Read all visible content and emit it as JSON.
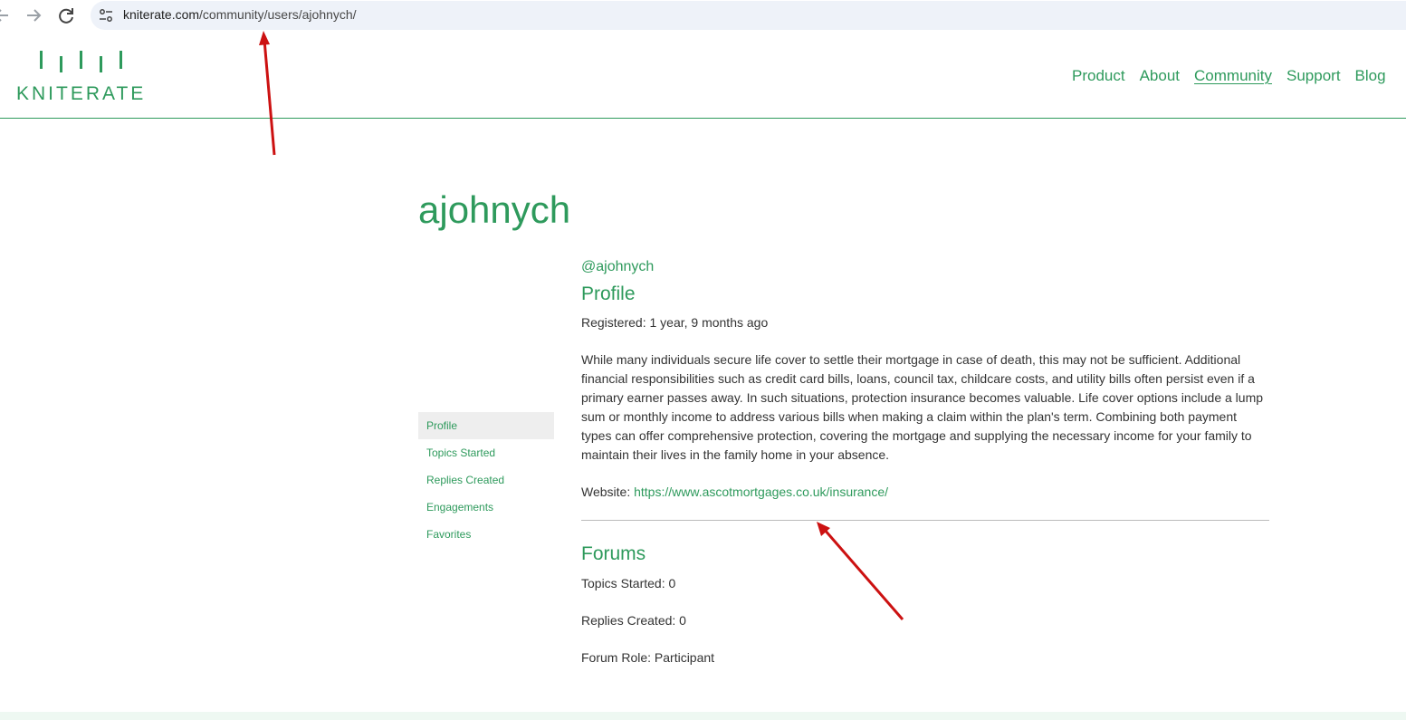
{
  "browser": {
    "url_domain": "kniterate.com",
    "url_path": "/community/users/ajohnych/"
  },
  "header": {
    "logo_text": "KNITERATE",
    "nav": [
      {
        "label": "Product"
      },
      {
        "label": "About"
      },
      {
        "label": "Community",
        "active": true
      },
      {
        "label": "Support"
      },
      {
        "label": "Blog"
      }
    ]
  },
  "profile": {
    "display_name": "ajohnych",
    "handle": "@ajohnych",
    "profile_heading": "Profile",
    "registered": "Registered: 1 year, 9 months ago",
    "bio": "While many individuals secure life cover to settle their mortgage in case of death, this may not be sufficient. Additional financial responsibilities such as credit card bills, loans, council tax, childcare costs, and utility bills often persist even if a primary earner passes away. In such situations, protection insurance becomes valuable. Life cover options include a lump sum or monthly income to address various bills when making a claim within the plan's term. Combining both payment types can offer comprehensive protection, covering the mortgage and supplying the necessary income for your family to maintain their lives in the family home in your absence.",
    "website_label": "Website: ",
    "website_url": "https://www.ascotmortgages.co.uk/insurance/",
    "forums_heading": "Forums",
    "topics_started": "Topics Started: 0",
    "replies_created": "Replies Created: 0",
    "forum_role": "Forum Role: Participant"
  },
  "side_menu": [
    {
      "label": "Profile",
      "current": true
    },
    {
      "label": "Topics Started"
    },
    {
      "label": "Replies Created"
    },
    {
      "label": "Engagements"
    },
    {
      "label": "Favorites"
    }
  ],
  "colors": {
    "brand_green": "#2e9a5c",
    "annotation_red": "#cc1111"
  }
}
